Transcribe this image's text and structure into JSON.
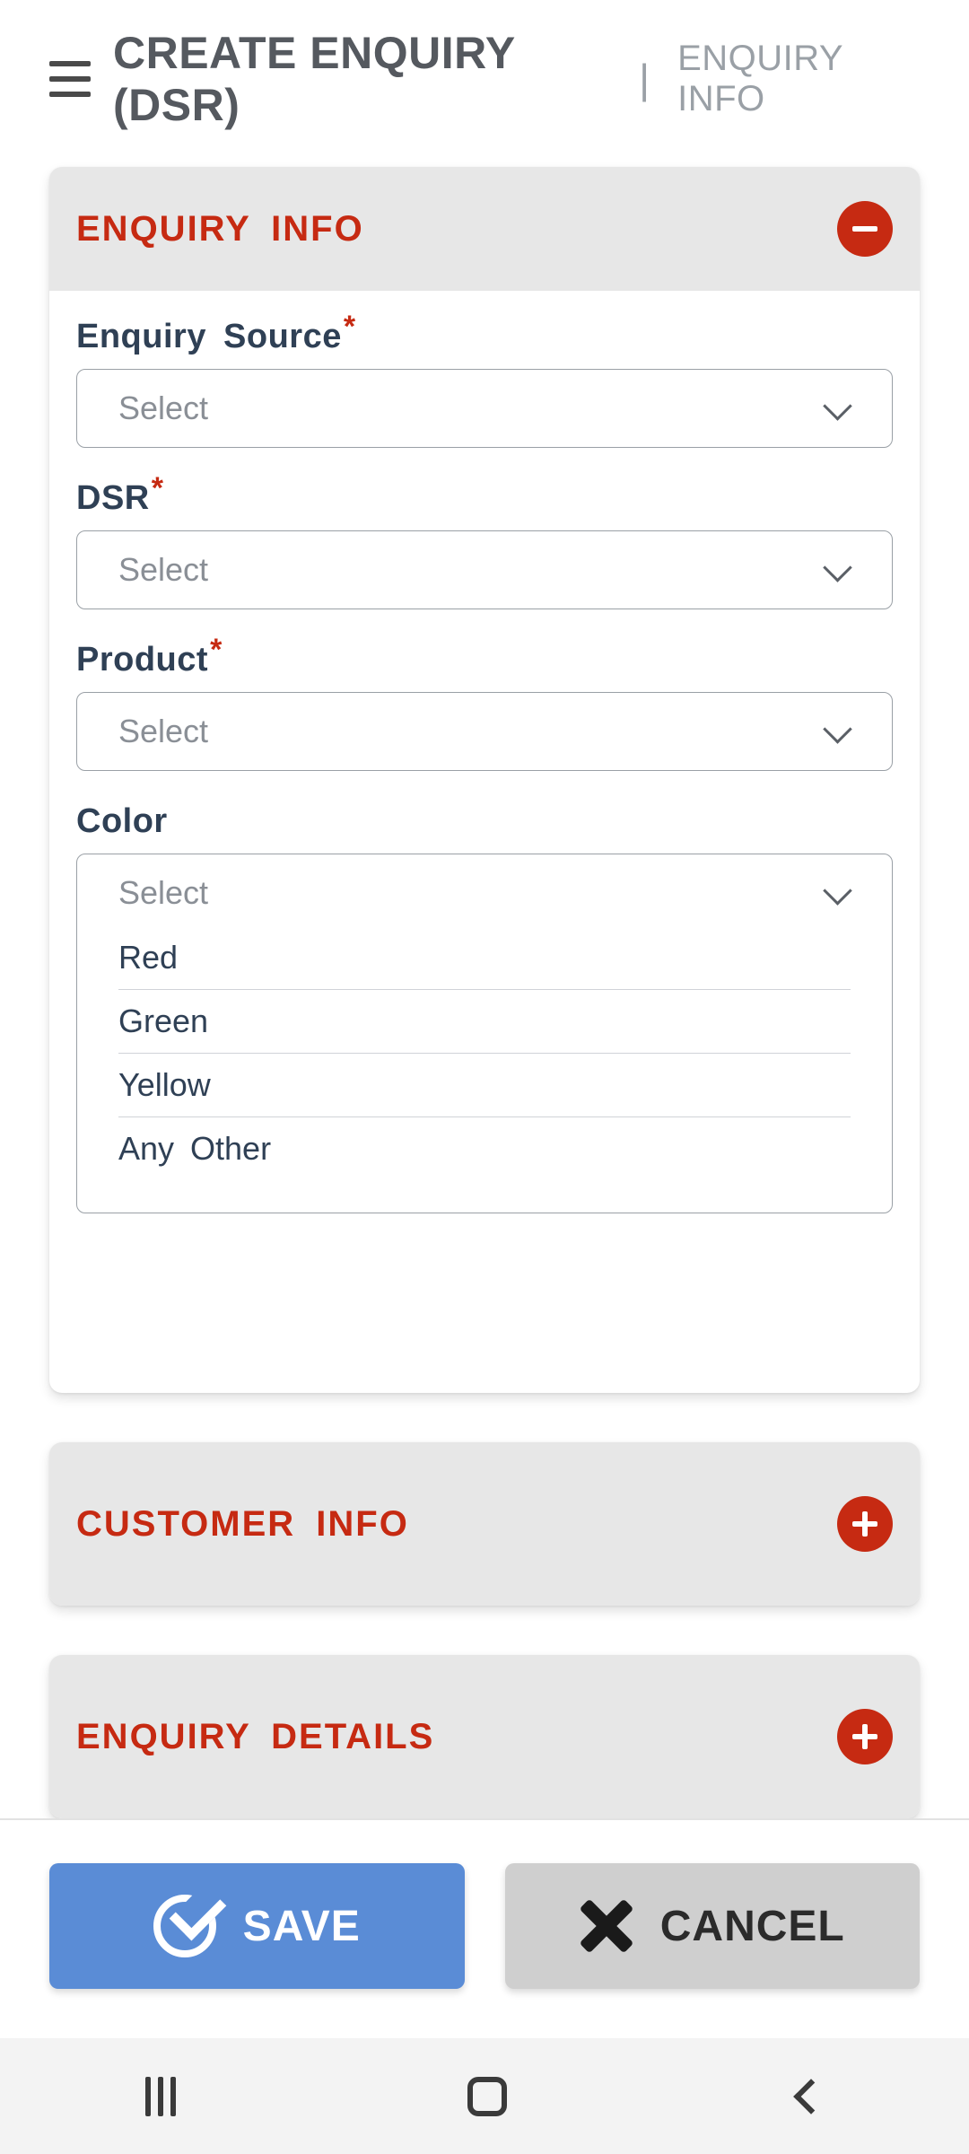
{
  "header": {
    "title": "CREATE ENQUIRY (DSR)",
    "subtitle": "ENQUIRY INFO"
  },
  "sections": {
    "enquiry_info": {
      "title": "ENQUIRY  INFO"
    },
    "customer_info": {
      "title": "CUSTOMER  INFO"
    },
    "enquiry_details": {
      "title": "ENQUIRY  DETAILS"
    }
  },
  "fields": {
    "enquiry_source": {
      "label": "Enquiry  Source",
      "placeholder": "Select"
    },
    "dsr": {
      "label": "DSR",
      "placeholder": "Select"
    },
    "product": {
      "label": "Product",
      "placeholder": "Select"
    },
    "color": {
      "label": "Color",
      "placeholder": "Select",
      "options": [
        "Red",
        "Green",
        "Yellow",
        "Any  Other"
      ]
    }
  },
  "buttons": {
    "save": "SAVE",
    "cancel": "CANCEL"
  },
  "colors": {
    "accent": "#c62a12",
    "primary_button": "#5a8cd6",
    "secondary_button": "#cfcfcf"
  }
}
